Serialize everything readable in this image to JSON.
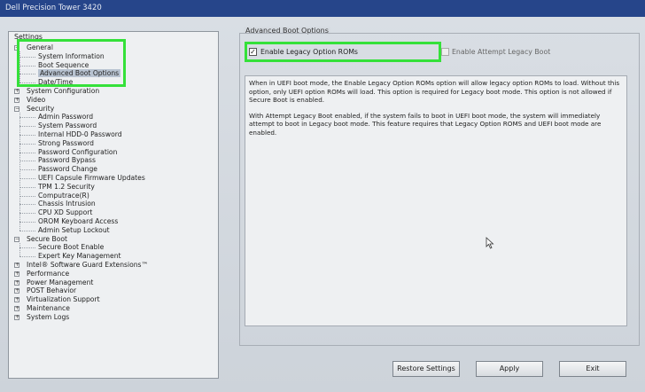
{
  "window": {
    "title": "Dell Precision Tower 3420"
  },
  "sidebar": {
    "heading": "Settings",
    "items": [
      {
        "label": "General",
        "indent": 0,
        "expander": "−"
      },
      {
        "label": "System Information",
        "indent": 1
      },
      {
        "label": "Boot Sequence",
        "indent": 1
      },
      {
        "label": "Advanced Boot Options",
        "indent": 1,
        "selected": true
      },
      {
        "label": "Date/Time",
        "indent": 1
      },
      {
        "label": "System Configuration",
        "indent": 0,
        "expander": "+"
      },
      {
        "label": "Video",
        "indent": 0,
        "expander": "+"
      },
      {
        "label": "Security",
        "indent": 0,
        "expander": "−"
      },
      {
        "label": "Admin Password",
        "indent": 1
      },
      {
        "label": "System Password",
        "indent": 1
      },
      {
        "label": "Internal HDD-0 Password",
        "indent": 1
      },
      {
        "label": "Strong Password",
        "indent": 1
      },
      {
        "label": "Password Configuration",
        "indent": 1
      },
      {
        "label": "Password Bypass",
        "indent": 1
      },
      {
        "label": "Password Change",
        "indent": 1
      },
      {
        "label": "UEFI Capsule Firmware Updates",
        "indent": 1
      },
      {
        "label": "TPM 1.2 Security",
        "indent": 1
      },
      {
        "label": "Computrace(R)",
        "indent": 1
      },
      {
        "label": "Chassis Intrusion",
        "indent": 1
      },
      {
        "label": "CPU XD Support",
        "indent": 1
      },
      {
        "label": "OROM Keyboard Access",
        "indent": 1
      },
      {
        "label": "Admin Setup Lockout",
        "indent": 1
      },
      {
        "label": "Secure Boot",
        "indent": 0,
        "expander": "−"
      },
      {
        "label": "Secure Boot Enable",
        "indent": 1
      },
      {
        "label": "Expert Key Management",
        "indent": 1
      },
      {
        "label": "Intel® Software Guard Extensions™",
        "indent": 0,
        "expander": "+"
      },
      {
        "label": "Performance",
        "indent": 0,
        "expander": "+"
      },
      {
        "label": "Power Management",
        "indent": 0,
        "expander": "+"
      },
      {
        "label": "POST Behavior",
        "indent": 0,
        "expander": "+"
      },
      {
        "label": "Virtualization Support",
        "indent": 0,
        "expander": "+"
      },
      {
        "label": "Maintenance",
        "indent": 0,
        "expander": "+"
      },
      {
        "label": "System Logs",
        "indent": 0,
        "expander": "+"
      }
    ]
  },
  "main": {
    "group_title": "Advanced Boot Options",
    "option1": {
      "label": "Enable Legacy Option ROMs",
      "checked": true,
      "check_glyph": "✓"
    },
    "option2": {
      "label": "Enable Attempt Legacy Boot",
      "checked": false
    },
    "description": {
      "p1": "When in UEFI boot mode, the Enable Legacy Option ROMs option will allow legacy option ROMs to load. Without this option, only UEFI option ROMs will load. This option is required for Legacy boot mode. This option is not allowed if Secure Boot is enabled.",
      "p2": "With Attempt Legacy Boot enabled, if the system fails to boot in UEFI boot mode, the system will immediately attempt to boot in Legacy boot mode. This feature requires that Legacy Option ROMS and UEFI boot mode are enabled."
    }
  },
  "buttons": {
    "restore": "Restore Settings",
    "apply": "Apply",
    "exit": "Exit"
  },
  "colors": {
    "titlebar": "#26458a",
    "highlight": "#35e13a",
    "selection": "#b8c3d1"
  }
}
